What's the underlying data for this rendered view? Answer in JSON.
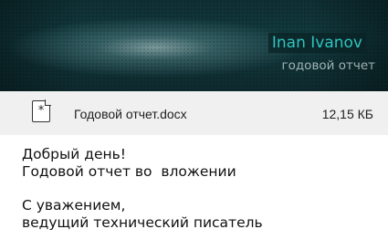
{
  "header": {
    "sender_name": "Inan Ivanov",
    "subject": "годовой отчет"
  },
  "attachment": {
    "icon": "document-icon",
    "file_name": "Годовой отчет.docx",
    "file_size": "12,15 КБ"
  },
  "message": {
    "greeting": "Добрый день!",
    "line2": "Годовой отчет во  вложении",
    "closing": "С уважением,",
    "signature": "ведущий технический писатель"
  },
  "colors": {
    "accent": "#2fc4bf",
    "header_bg": "#123a3e",
    "attachment_bg": "#f0f0f0"
  }
}
